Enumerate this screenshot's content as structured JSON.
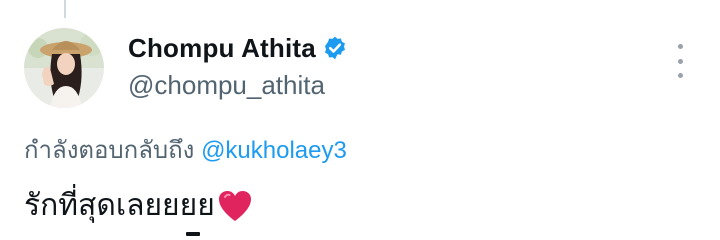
{
  "tweet": {
    "author": {
      "display_name": "Chompu Athita",
      "handle": "@chompu_athita",
      "verified": true
    },
    "reply_prefix": "กำลังตอบกลับถึง",
    "reply_to": "@kukholaey3",
    "text": "รักที่สุดเลยยยย",
    "emoji": "red-heart-icon"
  },
  "colors": {
    "verified": "#1d9bf0",
    "mention": "#1d9bf0",
    "secondary_text": "#536471",
    "heart": "#e0245e"
  }
}
